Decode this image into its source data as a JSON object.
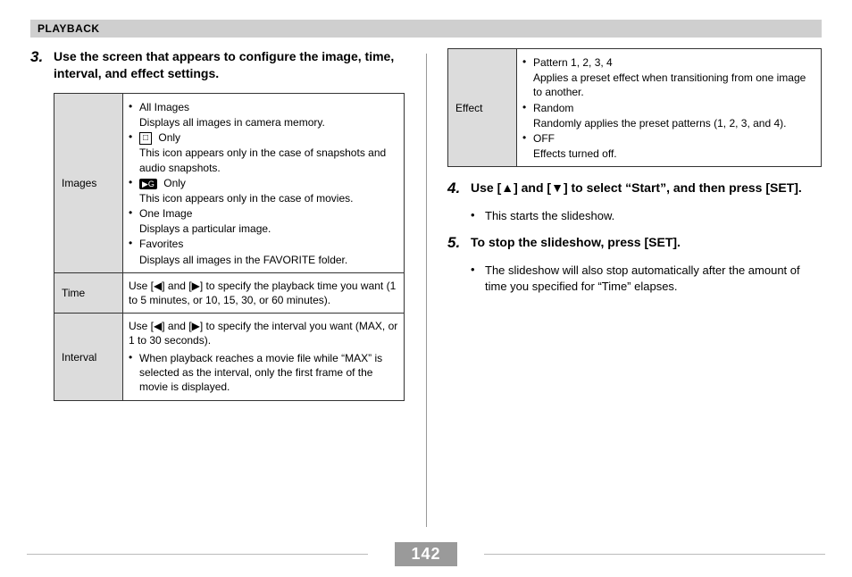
{
  "header": "PLAYBACK",
  "page_number": "142",
  "steps": {
    "s3": {
      "num": "3.",
      "title": "Use the screen that appears to configure the image, time, interval, and effect settings."
    },
    "s4": {
      "num": "4.",
      "title": "Use [▲] and [▼] to select “Start”, and then press [SET].",
      "sub": "This starts the slideshow."
    },
    "s5": {
      "num": "5.",
      "title": "To stop the slideshow, press [SET].",
      "sub": "The slideshow will also stop automatically after the amount of time you specified for “Time” elapses."
    }
  },
  "table1": {
    "images": {
      "key": "Images",
      "r1": "All Images",
      "r1d": "Displays all images in camera memory.",
      "r2a": " Only",
      "r2d": "This icon appears only in the case of snapshots and audio snapshots.",
      "r3a": " Only",
      "r3d": "This icon appears only in the case of movies.",
      "r4": "One Image",
      "r4d": "Displays a particular image.",
      "r5": "Favorites",
      "r5d": "Displays all images in the FAVORITE folder."
    },
    "time": {
      "key": "Time",
      "txt": "Use [◀] and [▶] to specify the playback time you want (1 to 5 minutes, or 10, 15, 30, or 60 minutes)."
    },
    "interval": {
      "key": "Interval",
      "txt1": "Use [◀] and [▶] to specify the interval you want (MAX, or 1 to 30 seconds).",
      "txt2": "When playback reaches a movie file while “MAX” is selected as the interval, only the first frame of the movie is displayed."
    }
  },
  "table2": {
    "effect": {
      "key": "Effect",
      "r1": "Pattern 1, 2, 3, 4",
      "r1d": "Applies a preset effect when transitioning from one image to another.",
      "r2": "Random",
      "r2d": "Randomly applies the preset patterns (1, 2, 3, and 4).",
      "r3": "OFF",
      "r3d": "Effects turned off."
    }
  },
  "icons": {
    "snap": "□",
    "movie": "▶G"
  }
}
